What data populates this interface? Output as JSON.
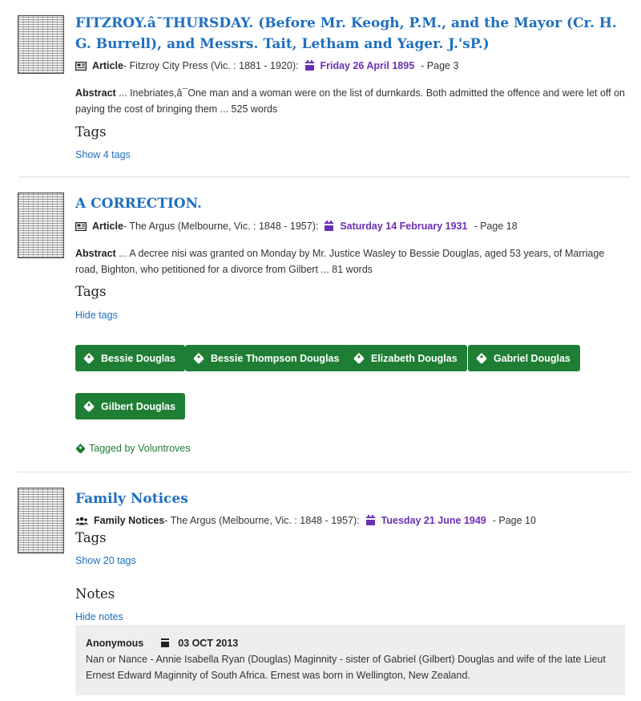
{
  "results": [
    {
      "title": "FITZROY.â¯THURSDAY. (Before Mr. Keogh, P.M., and the Mayor (Cr. H. G. Burrell), and Messrs. Tait, Letham and Yager. J.'sP.)",
      "type_icon": "newspaper-icon",
      "type": "Article",
      "source": "- Fitzroy City Press (Vic. : 1881 - 1920):",
      "date": "Friday 26 April 1895",
      "page": "- Page 3",
      "abstract_label": "Abstract",
      "abstract": " ... Inebriates,â¯One man and a woman were on the list of durnkards. Both admitted the offence and were let off on paying the cost of bringing them ... 525 words",
      "tags_heading": "Tags",
      "tags_toggle": "Show 4 tags"
    },
    {
      "title": "A CORRECTION.",
      "type_icon": "newspaper-icon",
      "type": "Article",
      "source": "- The Argus (Melbourne, Vic. : 1848 - 1957):",
      "date": "Saturday 14 February 1931",
      "page": "- Page 18",
      "abstract_label": "Abstract",
      "abstract": " ... A decree nisi was granted on Monday by Mr. Justice Wasley to Bessie Douglas, aged 53 years, of Marriage road, Bighton, who petitioned for a divorce from Gilbert ... 81 words",
      "tags_heading": "Tags",
      "tags_toggle": "Hide tags",
      "tags": [
        "Bessie Douglas",
        "Bessie Thompson Douglas",
        "Elizabeth Douglas",
        "Gabriel Douglas",
        "Gilbert Douglas"
      ],
      "tagged_by": "Tagged by Voluntroves"
    },
    {
      "title": "Family Notices",
      "type_icon": "users-icon",
      "type": "Family Notices",
      "source": "- The Argus (Melbourne, Vic. : 1848 - 1957):",
      "date": "Tuesday 21 June 1949",
      "page": "- Page 10",
      "tags_heading": "Tags",
      "tags_toggle": "Show 20 tags",
      "notes_heading": "Notes",
      "notes_toggle": "Hide notes",
      "note": {
        "author": "Anonymous",
        "date": "03 OCT 2013",
        "text": "Nan or Nance - Annie Isabella Ryan (Douglas) Maginnity - sister of Gabriel (Gilbert) Douglas and wife of the late Lieut Ernest Edward Maginnity of South Africa. Ernest was born in Wellington, New Zealand."
      }
    }
  ],
  "colors": {
    "link": "#1f6fbf",
    "date": "#6b2fb3",
    "tag_button": "#1e7e34",
    "note_bg": "#eeeeee"
  }
}
